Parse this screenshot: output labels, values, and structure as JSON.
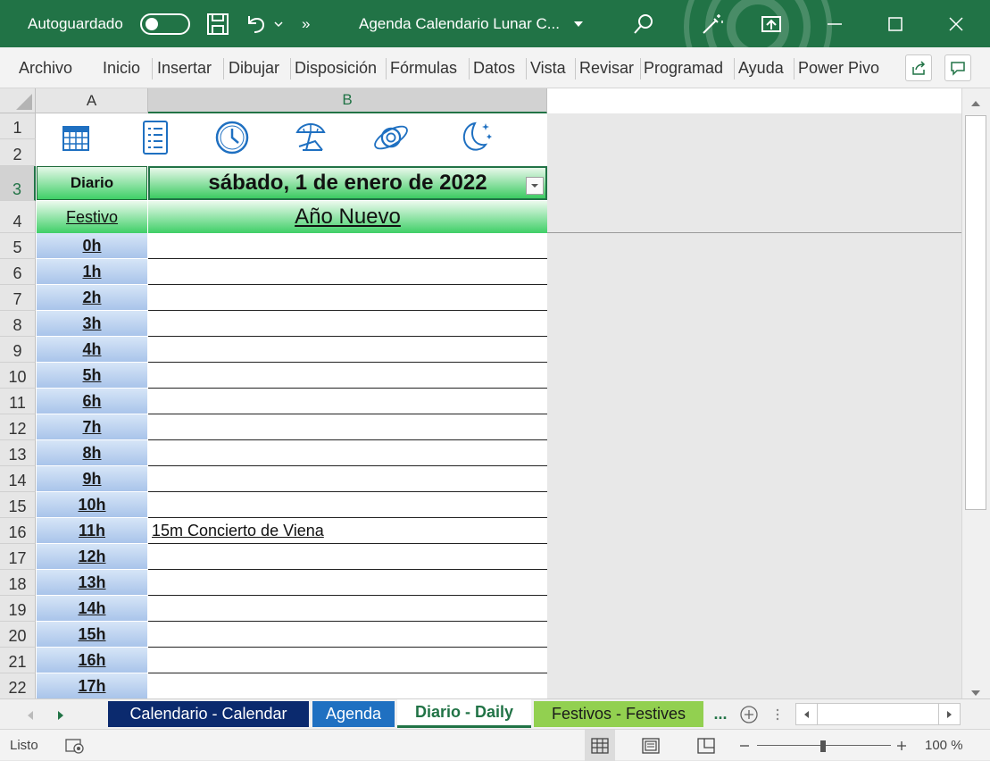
{
  "titlebar": {
    "autosave_label": "Autoguardado",
    "document_title": "Agenda Calendario Lunar C...",
    "more_label": "»"
  },
  "ribbon": {
    "tabs": [
      "Archivo",
      "Inicio",
      "Insertar",
      "Dibujar",
      "Disposición",
      "Fórmulas",
      "Datos",
      "Vista",
      "Revisar",
      "Programad",
      "Ayuda",
      "Power Pivo"
    ]
  },
  "sheet": {
    "columns": [
      "A",
      "B"
    ],
    "rows": [
      "1",
      "2",
      "3",
      "4",
      "5",
      "6",
      "7",
      "8",
      "9",
      "10",
      "11",
      "12",
      "13",
      "14",
      "15",
      "16",
      "17",
      "18",
      "19",
      "20",
      "21",
      "22"
    ],
    "diario_label": "Diario",
    "date_value": "sábado, 1 de enero de 2022",
    "festivo_label": "Festivo",
    "holiday_name": "Año Nuevo",
    "hours": [
      "0h",
      "1h",
      "2h",
      "3h",
      "4h",
      "5h",
      "6h",
      "7h",
      "8h",
      "9h",
      "10h",
      "11h",
      "12h",
      "13h",
      "14h",
      "15h",
      "16h",
      "17h"
    ],
    "entries": [
      "",
      "",
      "",
      "",
      "",
      "",
      "",
      "",
      "",
      "",
      "",
      "15m Concierto de Viena",
      "",
      "",
      "",
      "",
      "",
      ""
    ]
  },
  "icons": [
    "calendar-icon",
    "list-icon",
    "clock-icon",
    "beach-icon",
    "planet-icon",
    "moon-stars-icon"
  ],
  "sheet_tabs": [
    {
      "label": "Calendario - Calendar",
      "bg": "#0b2a6e",
      "fg": "#ffffff"
    },
    {
      "label": "Agenda",
      "bg": "#1f70c1",
      "fg": "#ffffff"
    },
    {
      "label": "Diario - Daily",
      "bg": "#ffffff",
      "fg": "#217346"
    },
    {
      "label": "Festivos - Festives",
      "bg": "#92d050",
      "fg": "#1a1a1a"
    }
  ],
  "tabs_more": "...",
  "status": {
    "ready": "Listo",
    "zoom": "100 %"
  },
  "colors": {
    "accent": "#217346",
    "hour_blue": "#a9c4ea",
    "header_green": "#3fcf67"
  }
}
